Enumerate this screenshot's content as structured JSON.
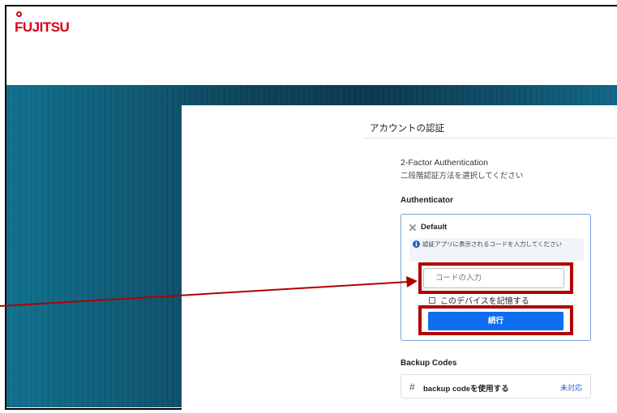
{
  "brand": {
    "logo_text": "FUJITSU"
  },
  "panel": {
    "title": "アカウントの認証",
    "heading": "2-Factor Authentication",
    "subheading": "二段階認証方法を選択してください"
  },
  "authenticator": {
    "section_label": "Authenticator",
    "card_title": "Default",
    "info_text": "認証アプリに表示されるコードを入力してください",
    "code_placeholder": "コードの入力",
    "remember_label": "このデバイスを記憶する",
    "submit_label": "続行"
  },
  "backup": {
    "section_label": "Backup Codes",
    "option_label": "backup codeを使用する",
    "status": "未対応"
  },
  "colors": {
    "brand_red": "#d4001a",
    "highlight": "#b00000",
    "primary_button": "#0d6ef2",
    "banner": "#0a4a66"
  }
}
